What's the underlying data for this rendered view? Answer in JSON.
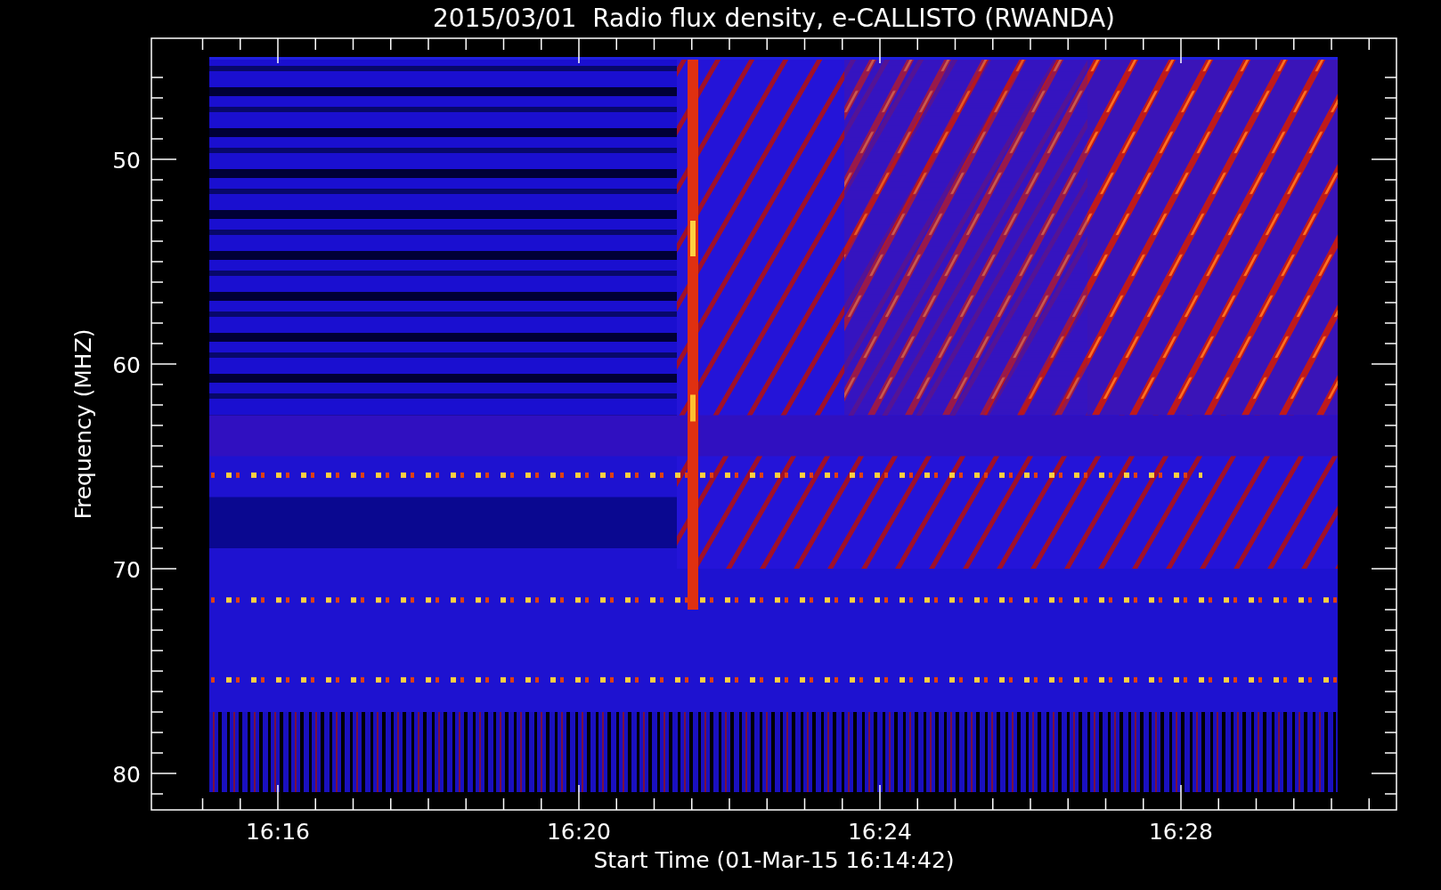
{
  "plot": {
    "title": "2015/03/01  Radio flux density, e-CALLISTO (RWANDA)",
    "ylabel": "Frequency (MHZ)",
    "xlabel": "Start Time (01-Mar-15 16:14:42)",
    "y_tick_labels": [
      "50",
      "60",
      "70",
      "80"
    ],
    "x_tick_labels": [
      "16:16",
      "16:20",
      "16:24",
      "16:28"
    ]
  }
}
